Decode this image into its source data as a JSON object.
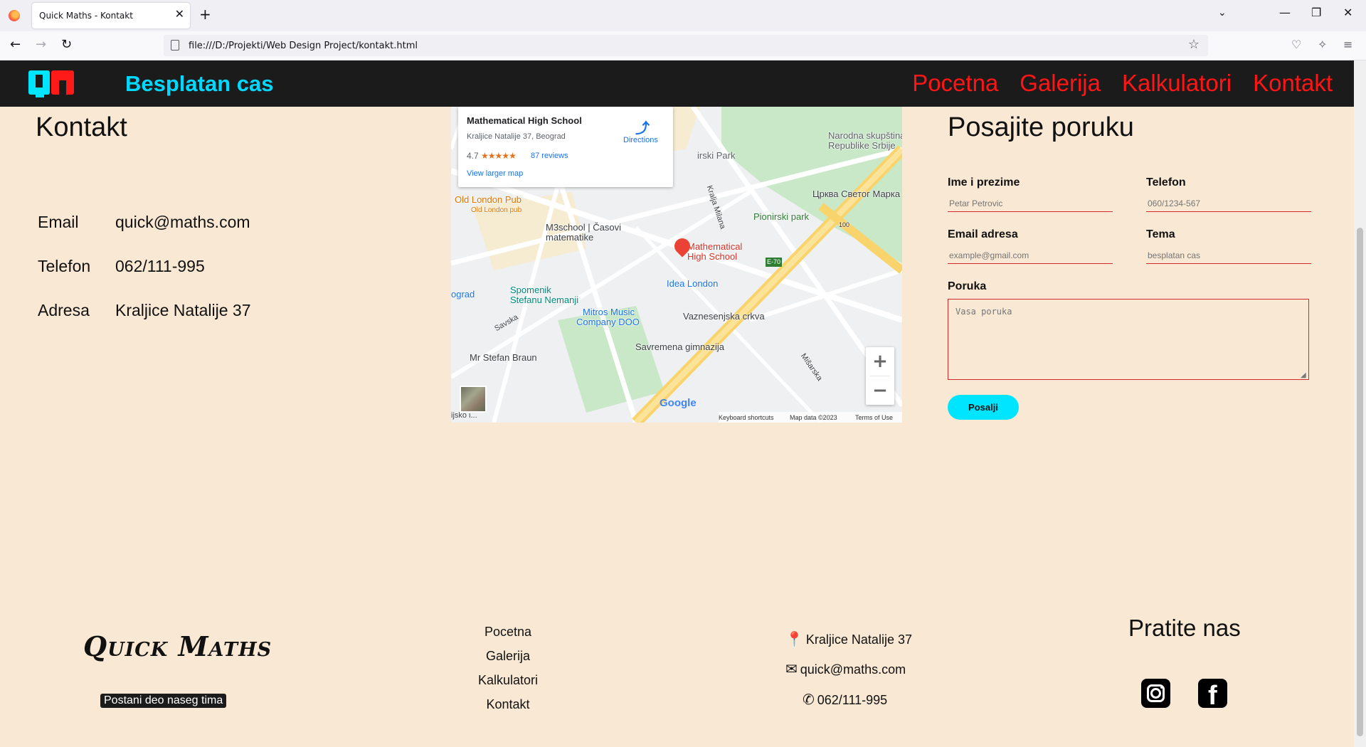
{
  "browser": {
    "tab_title": "Quick Maths - Kontakt",
    "tab_close": "✕",
    "new_tab": "+",
    "tabs_list": "⌄",
    "url": "file:///D:/Projekti/Web Design Project/kontakt.html",
    "minimize": "—",
    "restore": "❐",
    "close": "✕",
    "back": "←",
    "forward": "→",
    "reload": "↻",
    "bookmark": "☆",
    "pocket": "♡",
    "extensions": "✧",
    "menu": "≡"
  },
  "header": {
    "brand": "Besplatan cas",
    "nav": [
      "Pocetna",
      "Galerija",
      "Kalkulatori",
      "Kontakt"
    ],
    "colors": {
      "background": "#1b1b1b",
      "brand": "#00d8ff",
      "nav": "#ff1515"
    }
  },
  "contact": {
    "title": "Kontakt",
    "rows": [
      {
        "label": "Email",
        "value": "quick@maths.com"
      },
      {
        "label": "Telefon",
        "value": "062/111-995"
      },
      {
        "label": "Adresa",
        "value": "Kraljice Natalije 37"
      }
    ]
  },
  "map": {
    "place_name": "Mathematical High School",
    "place_address": "Kraljice Natalije 37, Beograd",
    "rating": "4.7",
    "stars": "★★★★★",
    "reviews": "87 reviews",
    "view_larger": "View larger map",
    "directions": "Directions",
    "directions_icon": "⤴",
    "labels": {
      "narodna": "Narodna skupština",
      "republike": "Republike Srbije",
      "park": "irski Park",
      "crkva": "Црква Светог Марка",
      "pionirski": "Pionirski park",
      "kralja_milana": "Kralja Milana",
      "old_london": "Old London Pub",
      "old_london_sub": "Old London pub",
      "m3school1": "M3school | Časovi",
      "m3school2": "matematike",
      "mhs1": "Mathematical",
      "mhs2": "High School",
      "idea": "Idea London",
      "road_100": "100",
      "road_e70": "E-70",
      "beograd": "ograd",
      "spomenik1": "Spomenik",
      "spomenik2": "Stefanu Nemanji",
      "mitros1": "Mitros Music",
      "mitros2": "Company DOO",
      "vaznesenjska": "Vaznesenjska crkva",
      "savska": "Savska",
      "braun": "Mr Stefan Braun",
      "savremena": "Savremena gimnazija",
      "misarska": "Mišarska",
      "bottom_left": "ijsko i..."
    },
    "zoom_in": "+",
    "zoom_out": "−",
    "google": "Google",
    "footer": {
      "shortcuts": "Keyboard shortcuts",
      "data": "Map data ©2023",
      "terms": "Terms of Use"
    }
  },
  "form": {
    "title": "Posajite poruku",
    "name_label": "Ime i prezime",
    "name_placeholder": "Petar Petrovic",
    "phone_label": "Telefon",
    "phone_placeholder": "060/1234-567",
    "email_label": "Email adresa",
    "email_placeholder": "example@gmail.com",
    "topic_label": "Tema",
    "topic_placeholder": "besplatan cas",
    "message_label": "Poruka",
    "message_placeholder": "Vasa poruka",
    "submit": "Posalji",
    "colors": {
      "underline": "#d22a2a",
      "button": "#00e5ff"
    }
  },
  "footer": {
    "logo": "Quick Maths",
    "cta": "Postani deo naseg tima",
    "links": [
      "Pocetna",
      "Galerija",
      "Kalkulatori",
      "Kontakt"
    ],
    "address": "Kraljice Natalije 37",
    "email": "quick@maths.com",
    "phone": "062/111-995",
    "address_icon": "📍",
    "email_icon": "✉",
    "phone_icon": "✆",
    "follow": "Pratite nas",
    "social": [
      "instagram-icon",
      "facebook-icon"
    ],
    "facebook_glyph": "f"
  }
}
